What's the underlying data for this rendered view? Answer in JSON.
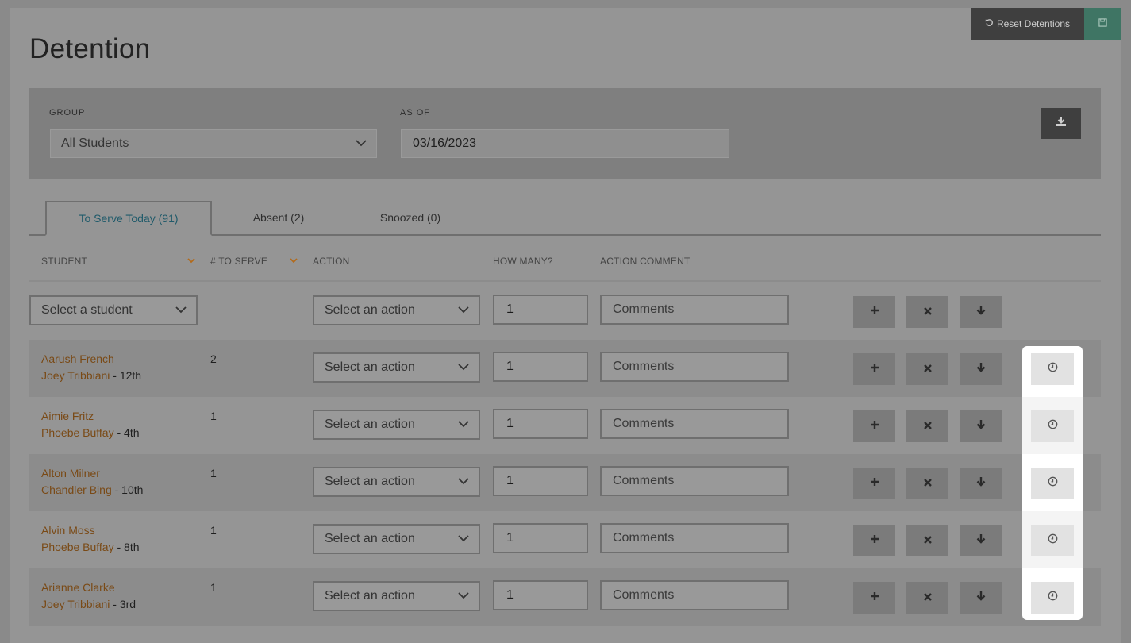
{
  "page": {
    "title": "Detention"
  },
  "top_actions": {
    "reset_label": "Reset Detentions",
    "reset_icon": "undo-icon",
    "save_icon": "floppy-disk-icon"
  },
  "filters": {
    "group_label": "GROUP",
    "group_value": "All Students",
    "as_of_label": "AS OF",
    "as_of_value": "03/16/2023",
    "download_icon": "download-icon"
  },
  "tabs": [
    {
      "label": "To Serve Today (91)",
      "active": true
    },
    {
      "label": "Absent (2)",
      "active": false
    },
    {
      "label": "Snoozed (0)",
      "active": false
    }
  ],
  "columns": {
    "student": "STUDENT",
    "to_serve": "# TO SERVE",
    "action": "ACTION",
    "how_many": "HOW MANY?",
    "action_comment": "ACTION COMMENT"
  },
  "new_row": {
    "student_placeholder": "Select a student",
    "action_placeholder": "Select an action",
    "how_many": "1",
    "comment_placeholder": "Comments"
  },
  "rows": [
    {
      "name": "Aarush French",
      "advisor": "Joey Tribbiani",
      "grade": " - 12th",
      "to_serve": "2",
      "action_placeholder": "Select an action",
      "how_many": "1",
      "comment_placeholder": "Comments"
    },
    {
      "name": "Aimie Fritz",
      "advisor": "Phoebe Buffay",
      "grade": " - 4th",
      "to_serve": "1",
      "action_placeholder": "Select an action",
      "how_many": "1",
      "comment_placeholder": "Comments"
    },
    {
      "name": "Alton Milner",
      "advisor": "Chandler Bing",
      "grade": " - 10th",
      "to_serve": "1",
      "action_placeholder": "Select an action",
      "how_many": "1",
      "comment_placeholder": "Comments"
    },
    {
      "name": "Alvin Moss",
      "advisor": "Phoebe Buffay",
      "grade": " - 8th",
      "to_serve": "1",
      "action_placeholder": "Select an action",
      "how_many": "1",
      "comment_placeholder": "Comments"
    },
    {
      "name": "Arianne Clarke",
      "advisor": "Joey Tribbiani",
      "grade": " - 3rd",
      "to_serve": "1",
      "action_placeholder": "Select an action",
      "how_many": "1",
      "comment_placeholder": "Comments"
    }
  ],
  "icons": {
    "add": "plus-icon",
    "remove": "times-icon",
    "move": "arrow-down-icon",
    "snooze": "clock-icon",
    "chevron": "chevron-down-icon",
    "sort": "caret-down-icon"
  },
  "colors": {
    "accent_link": "#7a4a16",
    "active_tab": "#1f5a6a",
    "save_green": "#3f7564",
    "dark_button": "#3f3f3f"
  }
}
